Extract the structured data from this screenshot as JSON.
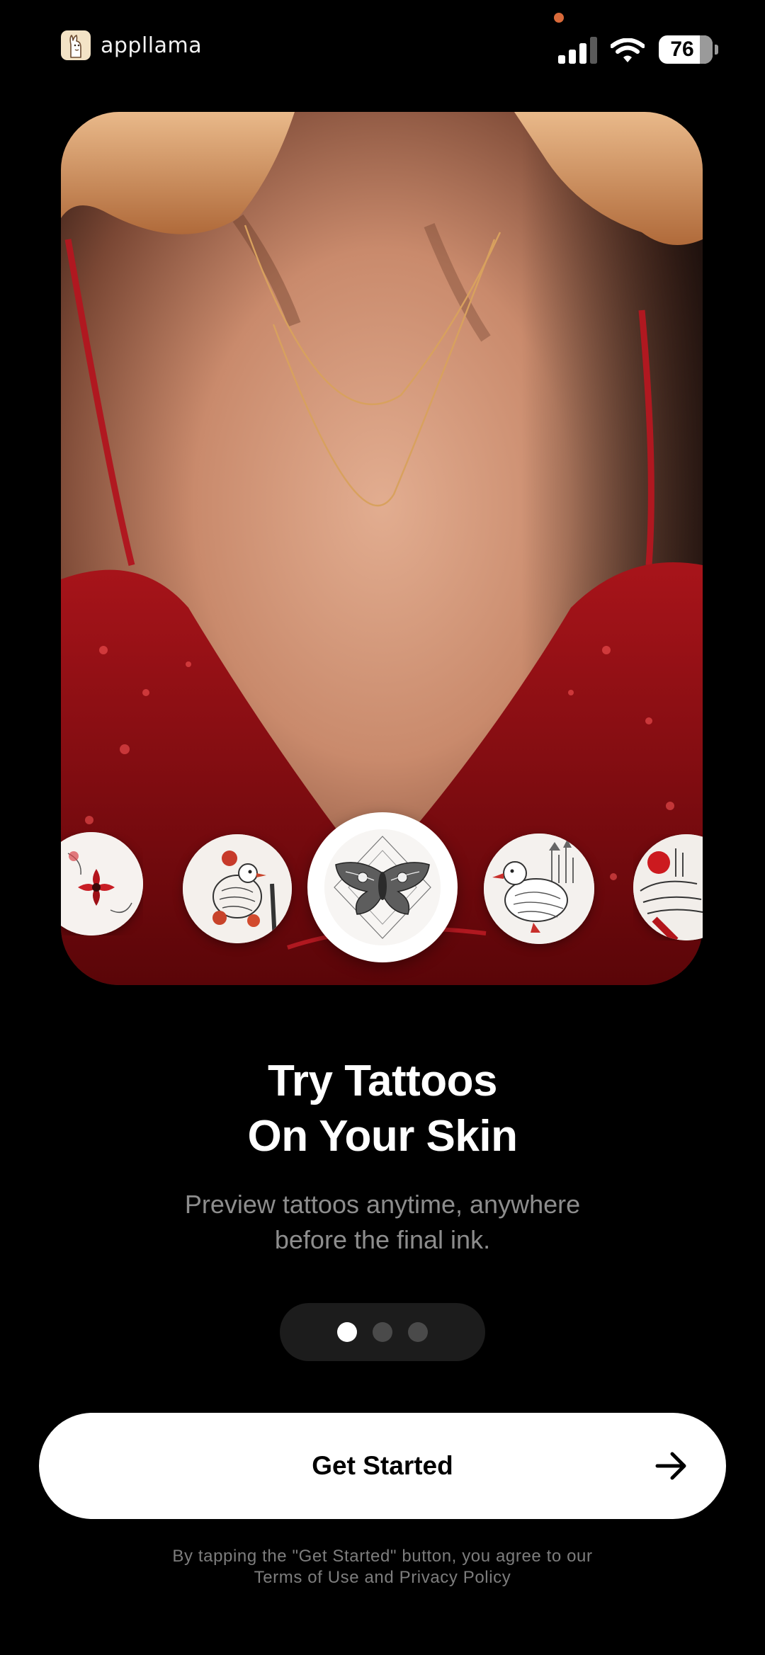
{
  "status_bar": {
    "brand_name": "appllama",
    "battery_level": "76",
    "icons": [
      "llama-logo-icon",
      "cellular-signal-icon",
      "wifi-icon",
      "battery-icon"
    ]
  },
  "hero": {
    "carousel": {
      "selected_index": 2,
      "items": [
        {
          "icon": "red-flower-tattoo-icon"
        },
        {
          "icon": "bird-and-flowers-tattoo-icon"
        },
        {
          "icon": "moth-tattoo-icon"
        },
        {
          "icon": "duck-and-castle-tattoo-icon"
        },
        {
          "icon": "red-sketch-tattoo-icon"
        }
      ]
    }
  },
  "onboarding": {
    "title_line1": "Try Tattoos",
    "title_line2": "On Your Skin",
    "subtitle_line1": "Preview tattoos anytime, anywhere",
    "subtitle_line2": "before the final ink.",
    "page_count": 3,
    "active_page": 0
  },
  "cta": {
    "label": "Get Started",
    "icon": "arrow-right-icon"
  },
  "legal": {
    "line1": "By tapping the \"Get Started\" button, you agree to our",
    "terms_label": "Terms of Use",
    "and_label": "and",
    "privacy_label": "Privacy Policy"
  },
  "colors": {
    "background": "#000000",
    "cta_background": "#ffffff",
    "subtitle": "#8d8d8d",
    "dot_active": "#ffffff",
    "dot_inactive": "#4a4a4a",
    "pager_background": "#1c1c1c"
  }
}
